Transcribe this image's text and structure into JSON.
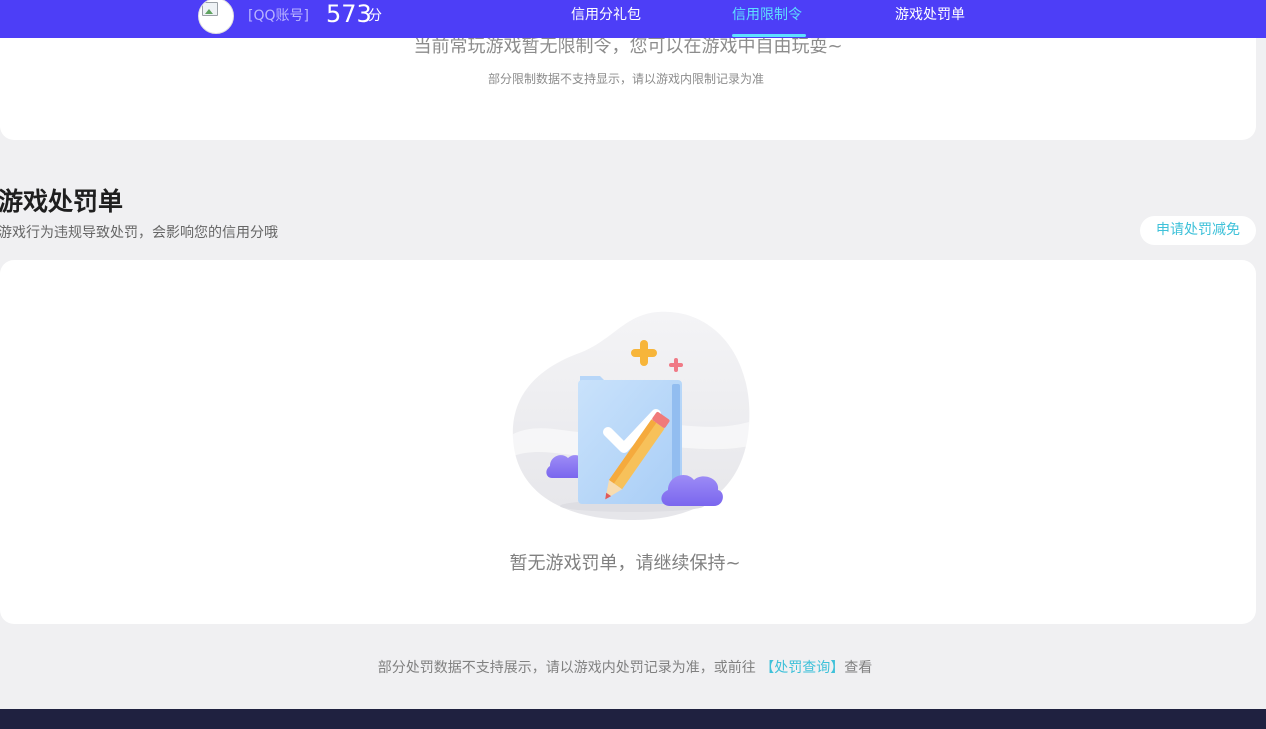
{
  "header": {
    "account_label": "[QQ账号]",
    "score": "573",
    "score_unit": "分",
    "nav": [
      {
        "label": "信用分礼包",
        "active": false
      },
      {
        "label": "信用限制令",
        "active": true
      },
      {
        "label": "游戏处罚单",
        "active": false
      }
    ],
    "bar_color": "#4d3ef7",
    "active_color": "#5fe0ff"
  },
  "limit_card": {
    "message": "当前常玩游戏暂无限制令，您可以在游戏中自由玩耍~",
    "note": "部分限制数据不支持显示，请以游戏内限制记录为准"
  },
  "penalty_section": {
    "title": "游戏处罚单",
    "subtitle": "游戏行为违规导致处罚，会影响您的信用分哦",
    "apply_button": "申请处罚减免",
    "empty_message": "暂无游戏罚单，请继续保持~",
    "illustration_icon": "document-check-pencil-icon"
  },
  "footer": {
    "note_prefix": "部分处罚数据不支持展示，请以游戏内处罚记录为准，或前往",
    "link_text": "【处罚查询】",
    "note_suffix": "查看"
  },
  "colors": {
    "accent_link": "#3ec1d9",
    "page_bg": "#f0f0f2",
    "bottom_bar": "#1f2140"
  }
}
